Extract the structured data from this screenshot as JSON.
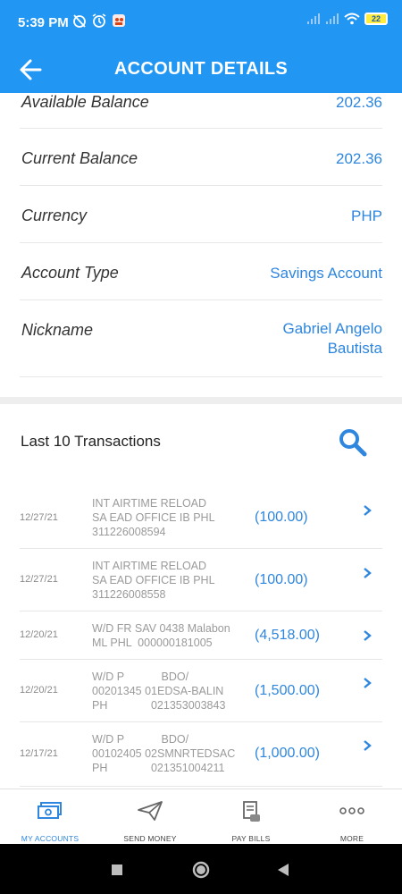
{
  "status_bar": {
    "time": "5:39 PM",
    "battery": "22",
    "icons": [
      "alarm-off-icon",
      "alarm-icon",
      "app-icon",
      "signal-icon",
      "signal-icon",
      "wifi-icon",
      "battery-icon"
    ]
  },
  "app_bar": {
    "title": "ACCOUNT DETAILS",
    "back_icon": "arrow-left-icon"
  },
  "details": [
    {
      "label": "Available Balance",
      "value": "202.36"
    },
    {
      "label": "Current Balance",
      "value": "202.36"
    },
    {
      "label": "Currency",
      "value": "PHP"
    },
    {
      "label": "Account Type",
      "value": "Savings Account"
    },
    {
      "label": "Nickname",
      "value": "Gabriel Angelo\nBautista"
    }
  ],
  "transactions_section": {
    "title": "Last 10 Transactions",
    "search_icon": "search-icon"
  },
  "transactions": [
    {
      "date": "12/27/21",
      "description": "INT AIRTIME RELOAD\nSA EAD OFFICE IB PHL\n311226008594",
      "amount": "(100.00)"
    },
    {
      "date": "12/27/21",
      "description": "INT AIRTIME RELOAD\nSA EAD OFFICE IB PHL\n311226008558",
      "amount": "(100.00)"
    },
    {
      "date": "12/20/21",
      "description": "W/D FR SAV 0438 Malabon\nML PHL  000000181005",
      "amount": "(4,518.00)"
    },
    {
      "date": "12/20/21",
      "description": "W/D P            BDO/\n00201345 01EDSA-BALIN\nPH              021353003843",
      "amount": "(1,500.00)"
    },
    {
      "date": "12/17/21",
      "description": "W/D P            BDO/\n00102405 02SMNRTEDSAC\nPH              021351004211",
      "amount": "(1,000.00)"
    }
  ],
  "bottom_nav": [
    {
      "label": "MY ACCOUNTS",
      "icon": "money-icon",
      "active": true
    },
    {
      "label": "SEND MONEY",
      "icon": "paper-plane-icon",
      "active": false
    },
    {
      "label": "PAY BILLS",
      "icon": "receipt-icon",
      "active": false
    },
    {
      "label": "MORE",
      "icon": "more-dots-icon",
      "active": false
    }
  ],
  "colors": {
    "primary": "#2196f3",
    "value_text": "#2e86de",
    "label_text": "#333333",
    "muted_text": "#9a9a9a"
  }
}
